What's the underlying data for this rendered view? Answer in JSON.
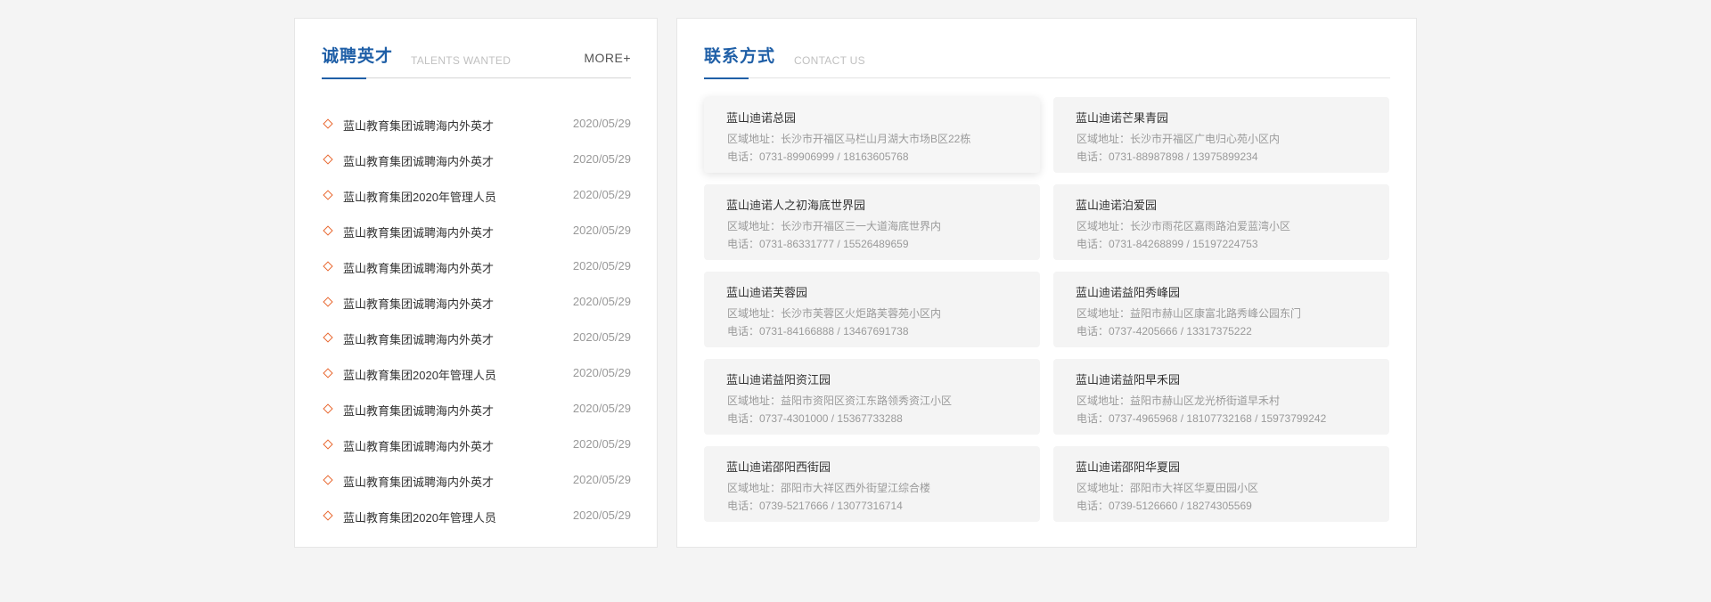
{
  "jobs": {
    "title": "诚聘英才",
    "subtitle": "TALENTS WANTED",
    "more_label": "MORE+",
    "items": [
      {
        "title": "蓝山教育集团诚聘海内外英才",
        "date": "2020/05/29"
      },
      {
        "title": "蓝山教育集团诚聘海内外英才",
        "date": "2020/05/29"
      },
      {
        "title": "蓝山教育集团2020年管理人员",
        "date": "2020/05/29"
      },
      {
        "title": "蓝山教育集团诚聘海内外英才",
        "date": "2020/05/29"
      },
      {
        "title": "蓝山教育集团诚聘海内外英才",
        "date": "2020/05/29"
      },
      {
        "title": "蓝山教育集团诚聘海内外英才",
        "date": "2020/05/29"
      },
      {
        "title": "蓝山教育集团诚聘海内外英才",
        "date": "2020/05/29"
      },
      {
        "title": "蓝山教育集团2020年管理人员",
        "date": "2020/05/29"
      },
      {
        "title": "蓝山教育集团诚聘海内外英才",
        "date": "2020/05/29"
      },
      {
        "title": "蓝山教育集团诚聘海内外英才",
        "date": "2020/05/29"
      },
      {
        "title": "蓝山教育集团诚聘海内外英才",
        "date": "2020/05/29"
      },
      {
        "title": "蓝山教育集团2020年管理人员",
        "date": "2020/05/29"
      }
    ]
  },
  "contact": {
    "title": "联系方式",
    "subtitle": "CONTACT US",
    "cards": [
      {
        "name": "蓝山迪诺总园",
        "address": "区域地址：长沙市开福区马栏山月湖大市场B区22栋",
        "phone": "电话：0731-89906999 / 18163605768"
      },
      {
        "name": "蓝山迪诺芒果青园",
        "address": "区域地址：长沙市开福区广电归心苑小区内",
        "phone": "电话：0731-88987898  / 13975899234"
      },
      {
        "name": "蓝山迪诺人之初海底世界园",
        "address": "区域地址：长沙市开福区三一大道海底世界内",
        "phone": "电话：0731-86331777 / 15526489659"
      },
      {
        "name": "蓝山迪诺泊爱园",
        "address": "区域地址：长沙市雨花区嘉雨路泊爱蓝湾小区",
        "phone": "电话：0731-84268899 / 15197224753"
      },
      {
        "name": "蓝山迪诺芙蓉园",
        "address": "区域地址：长沙市芙蓉区火炬路芙蓉苑小区内",
        "phone": "电话：0731-84166888 / 13467691738"
      },
      {
        "name": "蓝山迪诺益阳秀峰园",
        "address": "区域地址：益阳市赫山区康富北路秀峰公园东门",
        "phone": "电话：0737-4205666 / 13317375222"
      },
      {
        "name": "蓝山迪诺益阳资江园",
        "address": "区域地址：益阳市资阳区资江东路领秀资江小区",
        "phone": "电话：0737-4301000 / 15367733288"
      },
      {
        "name": "蓝山迪诺益阳早禾园",
        "address": "区域地址：益阳市赫山区龙光桥街道早禾村",
        "phone": "电话：0737-4965968 / 18107732168 / 15973799242"
      },
      {
        "name": "蓝山迪诺邵阳西街园",
        "address": "区域地址：邵阳市大祥区西外街望江综合楼",
        "phone": "电话：0739-5217666 / 13077316714"
      },
      {
        "name": "蓝山迪诺邵阳华夏园",
        "address": "区域地址：邵阳市大祥区华夏田园小区",
        "phone": "电话：0739-5126660 / 18274305569"
      }
    ]
  },
  "colors": {
    "accent": "#1f5fa7",
    "bullet": "#e8672f",
    "background": "#f4f4f4"
  }
}
